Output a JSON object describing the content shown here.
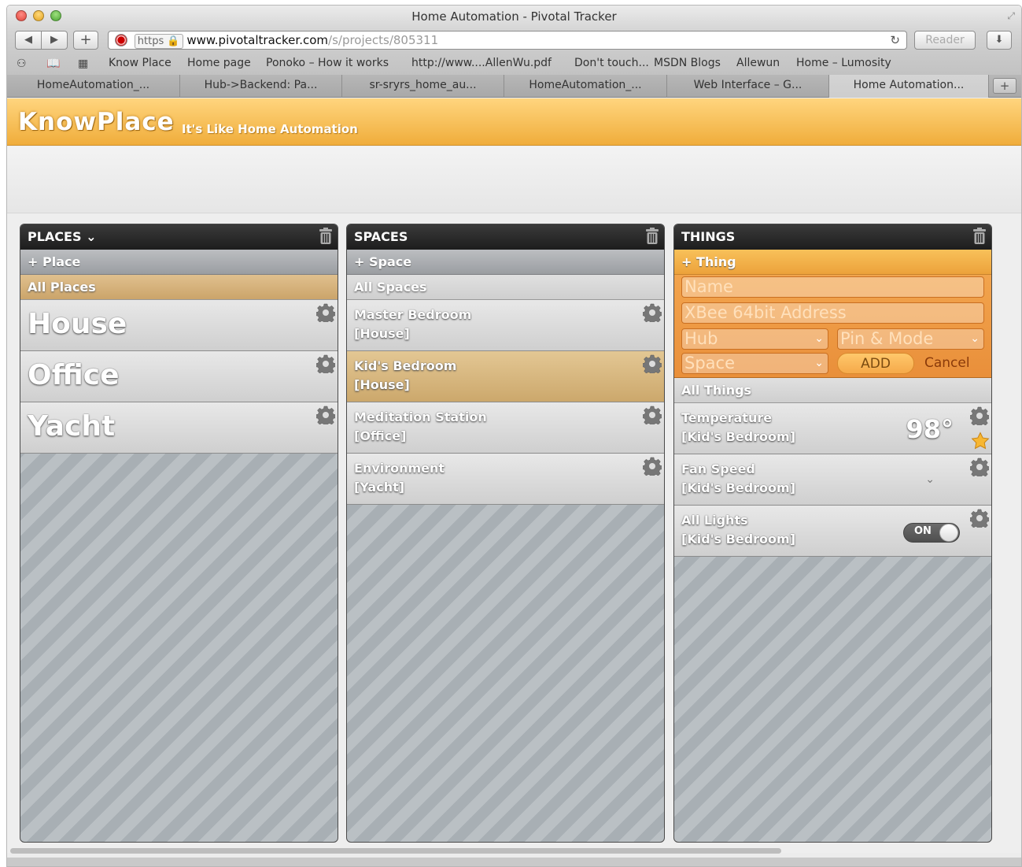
{
  "window": {
    "title": "Home Automation - Pivotal Tracker"
  },
  "toolbar": {
    "url_protocol": "https",
    "url_host": "www.pivotaltracker.com",
    "url_path": "/s/projects/805311",
    "reader_label": "Reader"
  },
  "bookmarks": [
    "Know Place",
    "Home page",
    "Ponoko – How it works",
    "http://www....AllenWu.pdf",
    "Don't touch...",
    "MSDN Blogs",
    "Allewun",
    "Home – Lumosity"
  ],
  "tabs": [
    "HomeAutomation_...",
    "Hub->Backend: Pa...",
    "sr-sryrs_home_au...",
    "HomeAutomation_...",
    "Web Interface – G...",
    "Home Automation..."
  ],
  "app": {
    "brand": "KnowPlace",
    "tagline": "It's Like Home Automation"
  },
  "places": {
    "header": "PLACES",
    "add_label": "+ Place",
    "all_label": "All Places",
    "items": [
      "House",
      "Office",
      "Yacht"
    ]
  },
  "spaces": {
    "header": "SPACES",
    "add_label": "+ Space",
    "all_label": "All Spaces",
    "items": [
      {
        "name": "Master Bedroom",
        "place": "[House]"
      },
      {
        "name": "Kid's Bedroom",
        "place": "[House]"
      },
      {
        "name": "Meditation Station",
        "place": "[Office]"
      },
      {
        "name": "Environment",
        "place": "[Yacht]"
      }
    ]
  },
  "things": {
    "header": "THINGS",
    "add_label": "+ Thing",
    "form": {
      "name_placeholder": "Name",
      "address_placeholder": "XBee 64bit Address",
      "hub_placeholder": "Hub",
      "pin_placeholder": "Pin & Mode",
      "space_placeholder": "Space",
      "add_label": "ADD",
      "cancel_label": "Cancel"
    },
    "all_label": "All Things",
    "items": [
      {
        "name": "Temperature",
        "space": "[Kid's Bedroom]",
        "value": "98°"
      },
      {
        "name": "Fan Speed",
        "space": "[Kid's Bedroom]"
      },
      {
        "name": "All Lights",
        "space": "[Kid's Bedroom]",
        "toggle": "ON"
      }
    ]
  },
  "colors": {
    "accent": "#f0ad3b",
    "form": "#ec963f",
    "selected": "#d4b27a"
  }
}
